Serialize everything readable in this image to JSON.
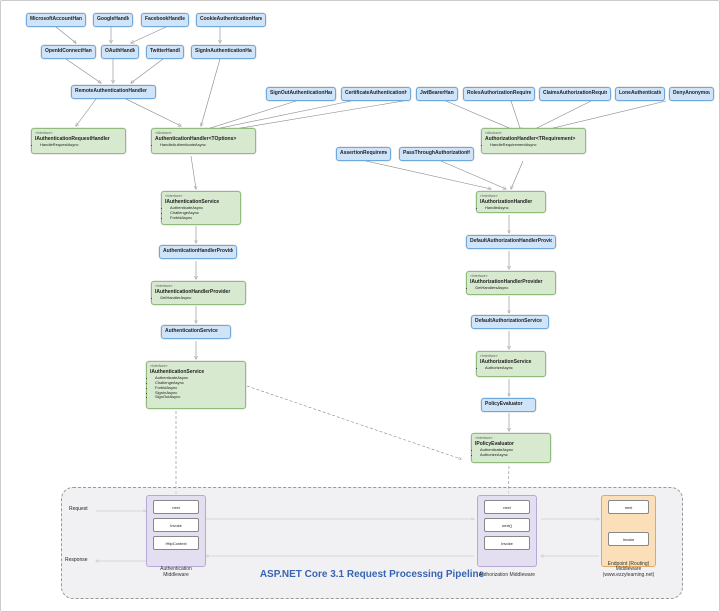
{
  "diagram": {
    "title": "ASP.NET Core 3.1 Request Processing Pipeline",
    "row1": {
      "ms": "MicrosoftAccountHandler",
      "goog": "GoogleHandler",
      "fb": "FacebookHandler",
      "cookie": "CookieAuthenticationHandler"
    },
    "row2": {
      "oidc": "OpenIdConnectHandler",
      "oauth": "OAuthHandler",
      "tw": "TwitterHandler",
      "signin": "SignInAuthenticationHandler"
    },
    "row3": {
      "remote": "RemoteAuthenticationHandler",
      "signout": "SignOutAuthenticationHandler",
      "cert": "CertificateAuthenticationHandler",
      "jwt": "JwtBearerHandler",
      "rolesreq": "RolesAuthorizationRequirement",
      "claimreq": "ClaimsAuthorizationRequirement",
      "lonereq": "LoneAuthenticationRequirement",
      "denyanon": "DenyAnonymousAuthorizationRequirement"
    },
    "row4": {
      "authreq": {
        "stereo": "«Interface»",
        "title": "IAuthenticationRequestHandler",
        "items": [
          "HandleRequestAsync"
        ]
      },
      "authhandlerT": {
        "stereo": "«Abstract»",
        "title": "AuthenticationHandler<TOptions>",
        "items": [
          "HandleAuthenticateAsync"
        ]
      },
      "assertreq": "AssertionRequirement",
      "passthru": "PassThroughAuthorizationHandler",
      "authzhandlerT": {
        "stereo": "«Abstract»",
        "title": "AuthorizationHandler<TRequirement>",
        "items": [
          "HandleRequirementAsync"
        ]
      }
    },
    "row5": {
      "iauthservice": {
        "stereo": "«Interface»",
        "title": "IAuthenticationService",
        "items": [
          "AuthenticateAsync",
          "ChallengeAsync",
          "ForbidAsync"
        ]
      },
      "iauthzhandler": {
        "stereo": "«Interface»",
        "title": "IAuthorizationHandler",
        "items": [
          "HandleAsync"
        ]
      }
    },
    "row6": {
      "ahp": "AuthenticationHandlerProvider",
      "dahp": "DefaultAuthorizationHandlerProvider"
    },
    "row7": {
      "iahp": {
        "stereo": "«Interface»",
        "title": "IAuthenticationHandlerProvider",
        "items": [
          "GetHandlerAsync"
        ]
      },
      "iazhp": {
        "stereo": "«Interface»",
        "title": "IAuthorizationHandlerProvider",
        "items": [
          "GetHandlersAsync"
        ]
      }
    },
    "row8": {
      "authservice": "AuthenticationService",
      "defauthzsvc": "DefaultAuthorizationService"
    },
    "row9": {
      "iauthsvc2": {
        "stereo": "«Interface»",
        "title": "IAuthenticationService",
        "items": [
          "AuthenticateAsync",
          "ChallengeAsync",
          "ForbidAsync",
          "SignInAsync",
          "SignOutAsync"
        ]
      },
      "iauthzsvc": {
        "stereo": "«Interface»",
        "title": "IAuthorizationService",
        "items": [
          "AuthorizeAsync"
        ]
      }
    },
    "row10": {
      "polevalblue": "PolicyEvaluator",
      "poleval": {
        "stereo": "«Interface»",
        "title": "IPolicyEvaluator",
        "items": [
          "AuthenticateAsync",
          "AuthorizeAsync"
        ]
      }
    },
    "pipeline": {
      "request_label": "Request",
      "response_label": "Response",
      "authn_mw": {
        "name": "Authentication Middleware",
        "steps": [
          "next",
          "Invoke",
          "HttpContext"
        ]
      },
      "authz_mw": {
        "name": "Authorization Middleware",
        "steps": [
          "next",
          "next()",
          "Invoke"
        ]
      },
      "endpoint_mw": {
        "name": "Endpoint (Routing) Middleware (www.ezzylearning.net)",
        "steps": [
          "next",
          "Invoke"
        ]
      }
    }
  }
}
